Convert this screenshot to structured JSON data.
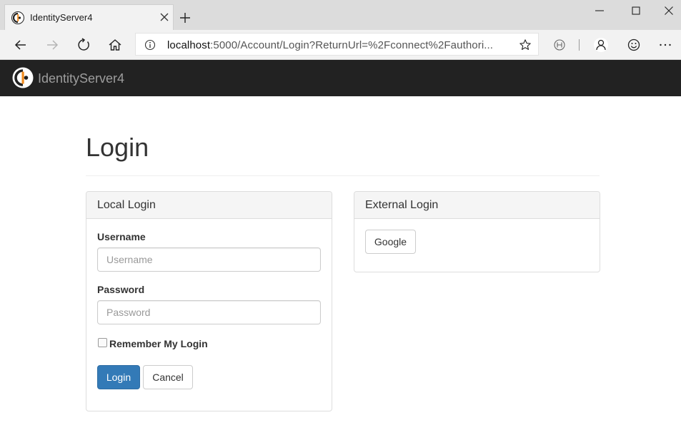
{
  "browser": {
    "tab_title": "IdentityServer4",
    "url_host": "localhost",
    "url_rest": ":5000/Account/Login?ReturnUrl=%2Fconnect%2Fauthori..."
  },
  "site": {
    "brand": "IdentityServer4",
    "navbar_color": "#222222"
  },
  "page": {
    "title": "Login"
  },
  "local_login": {
    "heading": "Local Login",
    "username_label": "Username",
    "username_placeholder": "Username",
    "username_value": "",
    "password_label": "Password",
    "password_placeholder": "Password",
    "password_value": "",
    "remember_label": "Remember My Login",
    "remember_checked": false,
    "login_button": "Login",
    "cancel_button": "Cancel",
    "primary_color": "#337ab7"
  },
  "external_login": {
    "heading": "External Login",
    "providers": [
      "Google"
    ]
  },
  "icons": [
    "identityserver-logo-icon",
    "close-icon",
    "plus-icon",
    "minimize-icon",
    "maximize-icon",
    "back-arrow-icon",
    "forward-arrow-icon",
    "refresh-icon",
    "home-icon",
    "info-icon",
    "star-icon",
    "reading-mode-icon",
    "profile-icon",
    "emoji-icon",
    "more-icon"
  ]
}
